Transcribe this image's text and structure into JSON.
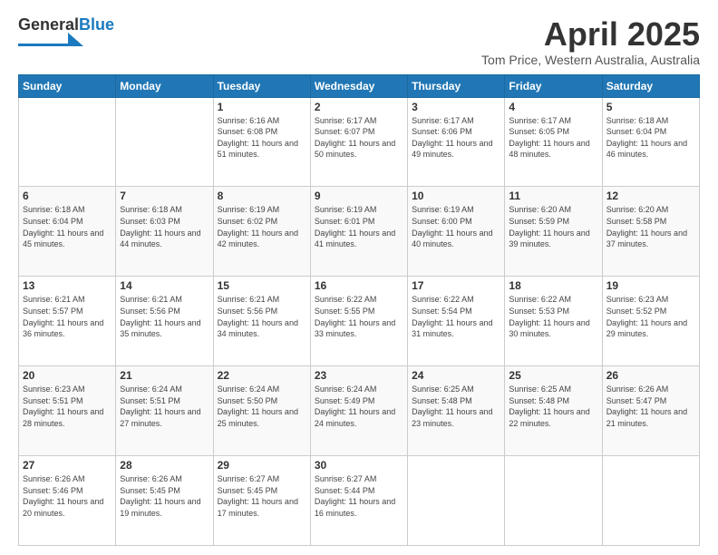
{
  "header": {
    "logo_line1": "General",
    "logo_line2": "Blue",
    "title": "April 2025",
    "subtitle": "Tom Price, Western Australia, Australia"
  },
  "weekdays": [
    "Sunday",
    "Monday",
    "Tuesday",
    "Wednesday",
    "Thursday",
    "Friday",
    "Saturday"
  ],
  "weeks": [
    [
      {
        "day": "",
        "info": ""
      },
      {
        "day": "",
        "info": ""
      },
      {
        "day": "1",
        "info": "Sunrise: 6:16 AM\nSunset: 6:08 PM\nDaylight: 11 hours and 51 minutes."
      },
      {
        "day": "2",
        "info": "Sunrise: 6:17 AM\nSunset: 6:07 PM\nDaylight: 11 hours and 50 minutes."
      },
      {
        "day": "3",
        "info": "Sunrise: 6:17 AM\nSunset: 6:06 PM\nDaylight: 11 hours and 49 minutes."
      },
      {
        "day": "4",
        "info": "Sunrise: 6:17 AM\nSunset: 6:05 PM\nDaylight: 11 hours and 48 minutes."
      },
      {
        "day": "5",
        "info": "Sunrise: 6:18 AM\nSunset: 6:04 PM\nDaylight: 11 hours and 46 minutes."
      }
    ],
    [
      {
        "day": "6",
        "info": "Sunrise: 6:18 AM\nSunset: 6:04 PM\nDaylight: 11 hours and 45 minutes."
      },
      {
        "day": "7",
        "info": "Sunrise: 6:18 AM\nSunset: 6:03 PM\nDaylight: 11 hours and 44 minutes."
      },
      {
        "day": "8",
        "info": "Sunrise: 6:19 AM\nSunset: 6:02 PM\nDaylight: 11 hours and 42 minutes."
      },
      {
        "day": "9",
        "info": "Sunrise: 6:19 AM\nSunset: 6:01 PM\nDaylight: 11 hours and 41 minutes."
      },
      {
        "day": "10",
        "info": "Sunrise: 6:19 AM\nSunset: 6:00 PM\nDaylight: 11 hours and 40 minutes."
      },
      {
        "day": "11",
        "info": "Sunrise: 6:20 AM\nSunset: 5:59 PM\nDaylight: 11 hours and 39 minutes."
      },
      {
        "day": "12",
        "info": "Sunrise: 6:20 AM\nSunset: 5:58 PM\nDaylight: 11 hours and 37 minutes."
      }
    ],
    [
      {
        "day": "13",
        "info": "Sunrise: 6:21 AM\nSunset: 5:57 PM\nDaylight: 11 hours and 36 minutes."
      },
      {
        "day": "14",
        "info": "Sunrise: 6:21 AM\nSunset: 5:56 PM\nDaylight: 11 hours and 35 minutes."
      },
      {
        "day": "15",
        "info": "Sunrise: 6:21 AM\nSunset: 5:56 PM\nDaylight: 11 hours and 34 minutes."
      },
      {
        "day": "16",
        "info": "Sunrise: 6:22 AM\nSunset: 5:55 PM\nDaylight: 11 hours and 33 minutes."
      },
      {
        "day": "17",
        "info": "Sunrise: 6:22 AM\nSunset: 5:54 PM\nDaylight: 11 hours and 31 minutes."
      },
      {
        "day": "18",
        "info": "Sunrise: 6:22 AM\nSunset: 5:53 PM\nDaylight: 11 hours and 30 minutes."
      },
      {
        "day": "19",
        "info": "Sunrise: 6:23 AM\nSunset: 5:52 PM\nDaylight: 11 hours and 29 minutes."
      }
    ],
    [
      {
        "day": "20",
        "info": "Sunrise: 6:23 AM\nSunset: 5:51 PM\nDaylight: 11 hours and 28 minutes."
      },
      {
        "day": "21",
        "info": "Sunrise: 6:24 AM\nSunset: 5:51 PM\nDaylight: 11 hours and 27 minutes."
      },
      {
        "day": "22",
        "info": "Sunrise: 6:24 AM\nSunset: 5:50 PM\nDaylight: 11 hours and 25 minutes."
      },
      {
        "day": "23",
        "info": "Sunrise: 6:24 AM\nSunset: 5:49 PM\nDaylight: 11 hours and 24 minutes."
      },
      {
        "day": "24",
        "info": "Sunrise: 6:25 AM\nSunset: 5:48 PM\nDaylight: 11 hours and 23 minutes."
      },
      {
        "day": "25",
        "info": "Sunrise: 6:25 AM\nSunset: 5:48 PM\nDaylight: 11 hours and 22 minutes."
      },
      {
        "day": "26",
        "info": "Sunrise: 6:26 AM\nSunset: 5:47 PM\nDaylight: 11 hours and 21 minutes."
      }
    ],
    [
      {
        "day": "27",
        "info": "Sunrise: 6:26 AM\nSunset: 5:46 PM\nDaylight: 11 hours and 20 minutes."
      },
      {
        "day": "28",
        "info": "Sunrise: 6:26 AM\nSunset: 5:45 PM\nDaylight: 11 hours and 19 minutes."
      },
      {
        "day": "29",
        "info": "Sunrise: 6:27 AM\nSunset: 5:45 PM\nDaylight: 11 hours and 17 minutes."
      },
      {
        "day": "30",
        "info": "Sunrise: 6:27 AM\nSunset: 5:44 PM\nDaylight: 11 hours and 16 minutes."
      },
      {
        "day": "",
        "info": ""
      },
      {
        "day": "",
        "info": ""
      },
      {
        "day": "",
        "info": ""
      }
    ]
  ]
}
